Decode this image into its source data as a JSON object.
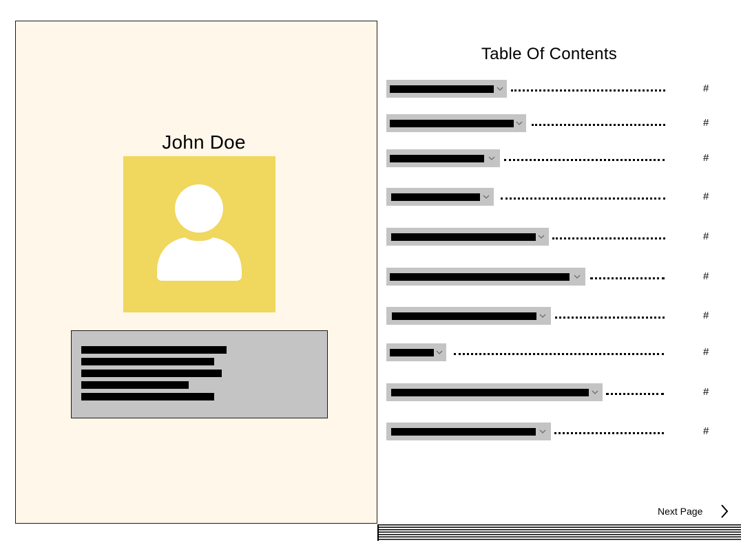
{
  "profile": {
    "name": "John Doe",
    "avatar_icon": "user-silhouette-icon",
    "avatar_bg": "#f0d75d"
  },
  "toc": {
    "title": "Table Of Contents",
    "entries": [
      {
        "page": "#"
      },
      {
        "page": "#"
      },
      {
        "page": "#"
      },
      {
        "page": "#"
      },
      {
        "page": "#"
      },
      {
        "page": "#"
      },
      {
        "page": "#"
      },
      {
        "page": "#"
      },
      {
        "page": "#"
      },
      {
        "page": "#"
      }
    ]
  },
  "navigation": {
    "next_label": "Next Page",
    "next_icon": "chevron-right-icon"
  },
  "colors": {
    "left_page_bg": "#fff7ea",
    "placeholder_gray": "#c4c4c4",
    "redaction": "#000000"
  }
}
